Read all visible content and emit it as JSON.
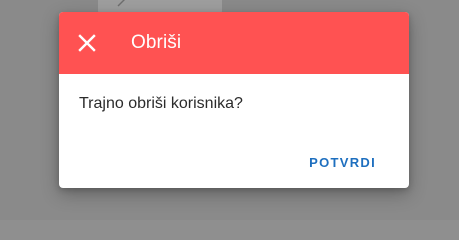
{
  "dialog": {
    "title": "Obriši",
    "message": "Trajno obriši korisnika?",
    "confirm_label": "POTVRDI",
    "close_icon": "close-icon"
  },
  "colors": {
    "header": "#ff5252",
    "confirm_text": "#1e6fbf",
    "backdrop": "#8a8a8a"
  }
}
